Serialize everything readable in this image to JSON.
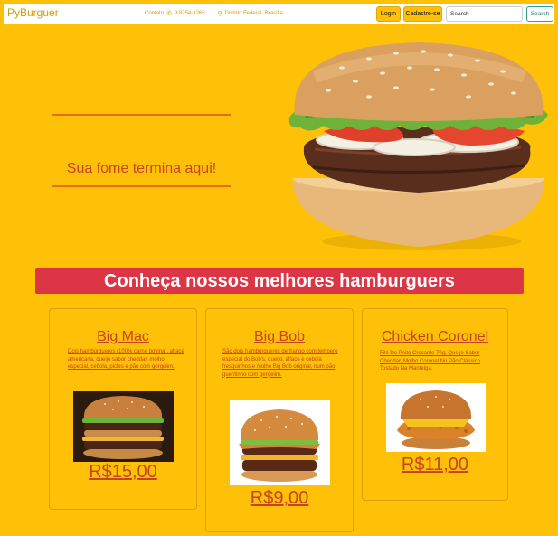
{
  "navbar": {
    "brand": "PyBurguer",
    "contact_label": "Contato",
    "phone": "9.8754-3265",
    "location": "Distrito Federal, Brasília",
    "login_label": "Login",
    "signup_label": "Cadastre-se",
    "search_placeholder": "Search",
    "search_button": "Search"
  },
  "hero": {
    "tagline": "Sua fome termina aqui!"
  },
  "section": {
    "title": "Conheça nossos melhores hamburguers"
  },
  "products": [
    {
      "name": "Big Mac",
      "description": "Dois hambúrgueres (100% carne bovina), alface americana, queijo sabor cheddar, molho especial, cebola, picles e pão com gergelim.",
      "price": "R$15,00"
    },
    {
      "name": "Big Bob",
      "description": "São dois hambúrgueres de frango com tempero especial do Bob's, queijo, alface e cebola fresquinhos e molho Big Bob original, num pão quentinho com gergelim.",
      "price": "R$9,00"
    },
    {
      "name": "Chicken Coronel",
      "description": "Filé De Peito Crocante 70g, Queijo Sabor Cheddar, Molho Coronel No Pão Clássico Tostado Na Manteiga.",
      "price": "R$11,00"
    }
  ],
  "colors": {
    "background": "#ffc107",
    "accent_red": "#dc3545",
    "text_orange": "#c8431f",
    "line_orange": "#e96b1e"
  }
}
